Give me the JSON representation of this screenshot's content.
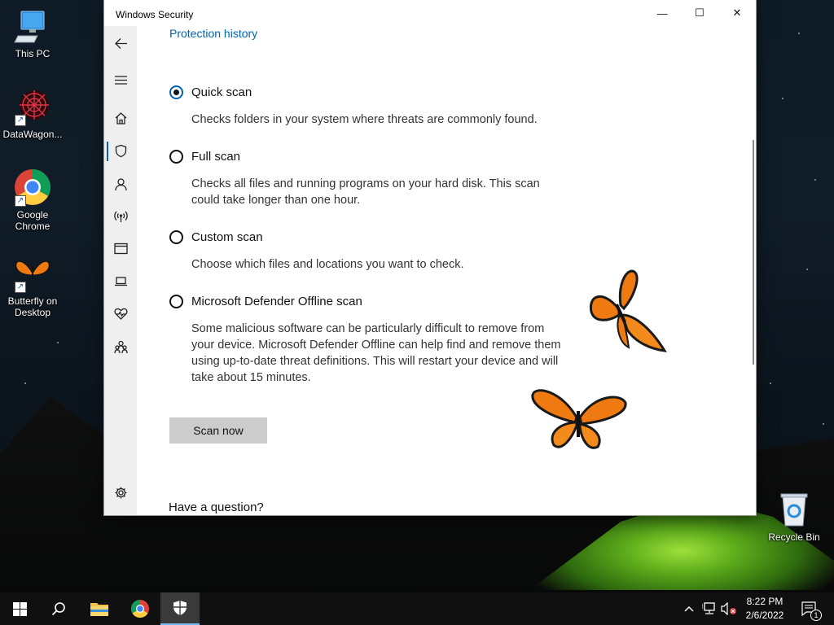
{
  "desktop": {
    "icons": [
      {
        "label": "This PC"
      },
      {
        "label": "DataWagon..."
      },
      {
        "label": "Google Chrome"
      },
      {
        "label": "Butterfly on Desktop"
      },
      {
        "label": "Recycle Bin"
      }
    ]
  },
  "window": {
    "title": "Windows Security",
    "controls": {
      "minimize": "—",
      "maximize": "☐",
      "close": "✕"
    }
  },
  "sidebar": {
    "items": [
      {
        "icon": "back-arrow-icon"
      },
      {
        "icon": "hamburger-menu-icon"
      },
      {
        "icon": "home-icon"
      },
      {
        "icon": "shield-icon",
        "active": true
      },
      {
        "icon": "person-icon"
      },
      {
        "icon": "wireless-icon"
      },
      {
        "icon": "app-browser-icon"
      },
      {
        "icon": "laptop-icon"
      },
      {
        "icon": "heart-pulse-icon"
      },
      {
        "icon": "family-icon"
      },
      {
        "icon": "gear-icon"
      }
    ],
    "accent": "#0063b1"
  },
  "content": {
    "protection_history_link": "Protection history",
    "options": [
      {
        "label": "Quick scan",
        "description": "Checks folders in your system where threats are commonly found.",
        "selected": true
      },
      {
        "label": "Full scan",
        "description": "Checks all files and running programs on your hard disk. This scan could take longer than one hour.",
        "selected": false
      },
      {
        "label": "Custom scan",
        "description": "Choose which files and locations you want to check.",
        "selected": false
      },
      {
        "label": "Microsoft Defender Offline scan",
        "description": "Some malicious software can be particularly difficult to remove from your device. Microsoft Defender Offline can help find and remove them using up-to-date threat definitions. This will restart your device and will take about 15 minutes.",
        "selected": false
      }
    ],
    "scan_button": "Scan now",
    "question_heading": "Have a question?"
  },
  "taskbar": {
    "items": [
      "start-icon",
      "search-icon",
      "file-explorer-icon",
      "chrome-icon",
      "windows-security-icon"
    ],
    "active": "windows-security-icon",
    "clock": {
      "time": "8:22 PM",
      "date": "2/6/2022"
    },
    "notification_count": "1"
  }
}
